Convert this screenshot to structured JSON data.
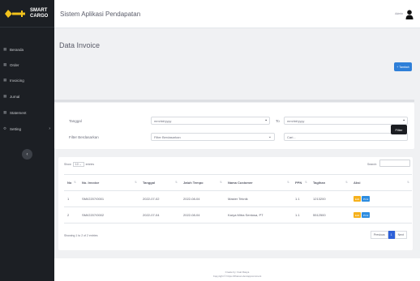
{
  "brand": {
    "line1": "SMART",
    "line2": "CARGO"
  },
  "sidebar": {
    "items": [
      {
        "label": "Beranda"
      },
      {
        "label": "Order"
      },
      {
        "label": "Invoicing"
      },
      {
        "label": "Jurnal"
      },
      {
        "label": "Statement"
      },
      {
        "label": "Setting"
      }
    ]
  },
  "header": {
    "title": "Sistem Aplikasi Pendapatan",
    "user": "Admin"
  },
  "page": {
    "title": "Data Invoice",
    "add_button": "+ Tambah"
  },
  "filter": {
    "tanggal_label": "Tanggal",
    "date_from": "mm/dd/yyyy",
    "to_label": "To",
    "date_to": "mm/dd/yyyy",
    "filter_by_label": "Filter Berdasarkan",
    "filter_by_value": "Filter Berdasarkan",
    "search_placeholder": "Cari...",
    "filter_button": "Filter"
  },
  "table": {
    "show_label": "Show",
    "entries_value": "10",
    "entries_label": "entries",
    "search_label": "Search:",
    "columns": [
      "No",
      "No. Invoice",
      "Tanggal",
      "Jatuh Tempo",
      "Nama Customer",
      "PPN",
      "Tagihan",
      "Aksi"
    ],
    "rows": [
      {
        "no": "1",
        "invoice": "SMI/2207/0001",
        "tanggal": "2022-07-02",
        "jatuh_tempo": "2022-08-04",
        "customer": "Master Teknik",
        "ppn": "1.1",
        "tagihan": "1213200"
      },
      {
        "no": "2",
        "invoice": "SMI/2207/0002",
        "tanggal": "2022-07-04",
        "jatuh_tempo": "2022-08-04",
        "customer": "Karya Mitra Sentosa, PT",
        "ppn": "1.1",
        "tagihan": "5512500"
      }
    ],
    "edit_label": "Edit",
    "print_label": "Print",
    "showing": "Showing 1 to 2 of 2 entries",
    "prev": "Previous",
    "page": "1",
    "next": "Next"
  },
  "footer": {
    "line1": "Create by: Irsal Rasya",
    "line2": "Copyright © https://dhanan.dev/appcomment"
  },
  "colors": {
    "sidebar": "#1c1f24",
    "accent_blue": "#2e7fd8",
    "edit": "#f6b11c",
    "logo": "#f2c21b"
  }
}
